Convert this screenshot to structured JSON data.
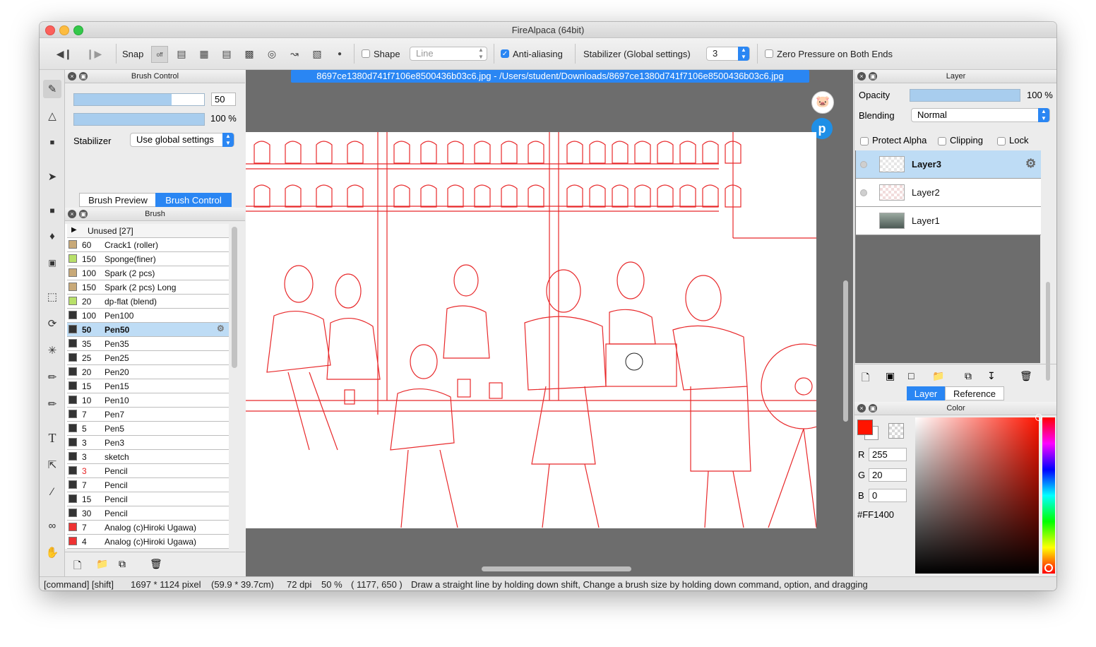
{
  "window": {
    "title": "FireAlpaca (64bit)"
  },
  "toolbar": {
    "snap_label": "Snap",
    "snap_off_label": "off",
    "shape_label": "Shape",
    "shape_value": "Line",
    "antialias_label": "Anti-aliasing",
    "stabilizer_label": "Stabilizer (Global settings)",
    "stabilizer_value": "3",
    "zero_pressure_label": "Zero Pressure on Both Ends"
  },
  "brush_control": {
    "title": "Brush Control",
    "size_value": "50",
    "size_fraction": 0.75,
    "opacity_value": "100 %",
    "stabilizer_label": "Stabilizer",
    "stabilizer_value": "Use global settings",
    "tabs": [
      "Brush Preview",
      "Brush Control"
    ]
  },
  "brush_panel": {
    "title": "Brush",
    "group": "Unused [27]",
    "items": [
      {
        "size": "60",
        "name": "Crack1 (roller)",
        "color": "#c8a978"
      },
      {
        "size": "150",
        "name": "Sponge(finer)",
        "color": "#b8e06a"
      },
      {
        "size": "100",
        "name": "Spark (2 pcs)",
        "color": "#c8a978"
      },
      {
        "size": "150",
        "name": "Spark (2 pcs) Long",
        "color": "#c8a978"
      },
      {
        "size": "20",
        "name": "dp-flat (blend)",
        "color": "#b8e06a"
      },
      {
        "size": "100",
        "name": "Pen100",
        "color": "#333333"
      },
      {
        "size": "50",
        "name": "Pen50",
        "color": "#333333"
      },
      {
        "size": "35",
        "name": "Pen35",
        "color": "#333333"
      },
      {
        "size": "25",
        "name": "Pen25",
        "color": "#333333"
      },
      {
        "size": "20",
        "name": "Pen20",
        "color": "#333333"
      },
      {
        "size": "15",
        "name": "Pen15",
        "color": "#333333"
      },
      {
        "size": "10",
        "name": "Pen10",
        "color": "#333333"
      },
      {
        "size": "7",
        "name": "Pen7",
        "color": "#333333"
      },
      {
        "size": "5",
        "name": "Pen5",
        "color": "#333333"
      },
      {
        "size": "3",
        "name": "Pen3",
        "color": "#333333"
      },
      {
        "size": "3",
        "name": "sketch",
        "color": "#333333"
      },
      {
        "size": "3",
        "name": "Pencil",
        "color": "#333333"
      },
      {
        "size": "7",
        "name": "Pencil",
        "color": "#333333"
      },
      {
        "size": "15",
        "name": "Pencil",
        "color": "#333333"
      },
      {
        "size": "30",
        "name": "Pencil",
        "color": "#333333"
      },
      {
        "size": "7",
        "name": "Analog (c)Hiroki Ugawa)",
        "color": "#ee3333"
      },
      {
        "size": "4",
        "name": "Analog (c)Hiroki Ugawa)",
        "color": "#ee3333"
      }
    ]
  },
  "document": {
    "tab_label": "8697ce1380d741f7106e8500436b03c6.jpg - /Users/student/Downloads/8697ce1380d741f7106e8500436b03c6.jpg"
  },
  "layer_panel": {
    "title": "Layer",
    "opacity_label": "Opacity",
    "opacity_value": "100 %",
    "blending_label": "Blending",
    "blending_value": "Normal",
    "protect_alpha_label": "Protect Alpha",
    "clipping_label": "Clipping",
    "lock_label": "Lock",
    "layers": [
      {
        "name": "Layer3"
      },
      {
        "name": "Layer2"
      },
      {
        "name": "Layer1"
      }
    ],
    "tabs": [
      "Layer",
      "Reference"
    ]
  },
  "color_panel": {
    "title": "Color",
    "r_label": "R",
    "r_value": "255",
    "g_label": "G",
    "g_value": "20",
    "b_label": "B",
    "b_value": "0",
    "hex": "#FF1400",
    "primary_color": "#ff1400"
  },
  "status": {
    "modifiers": "[command] [shift]",
    "pixels": "1697 * 1124 pixel",
    "size_cm": "(59.9 * 39.7cm)",
    "dpi": "72 dpi",
    "zoom": "50 %",
    "coords": "( 1177, 650 )",
    "hint": "Draw a straight line by holding down shift, Change a brush size by holding down command, option, and dragging"
  }
}
